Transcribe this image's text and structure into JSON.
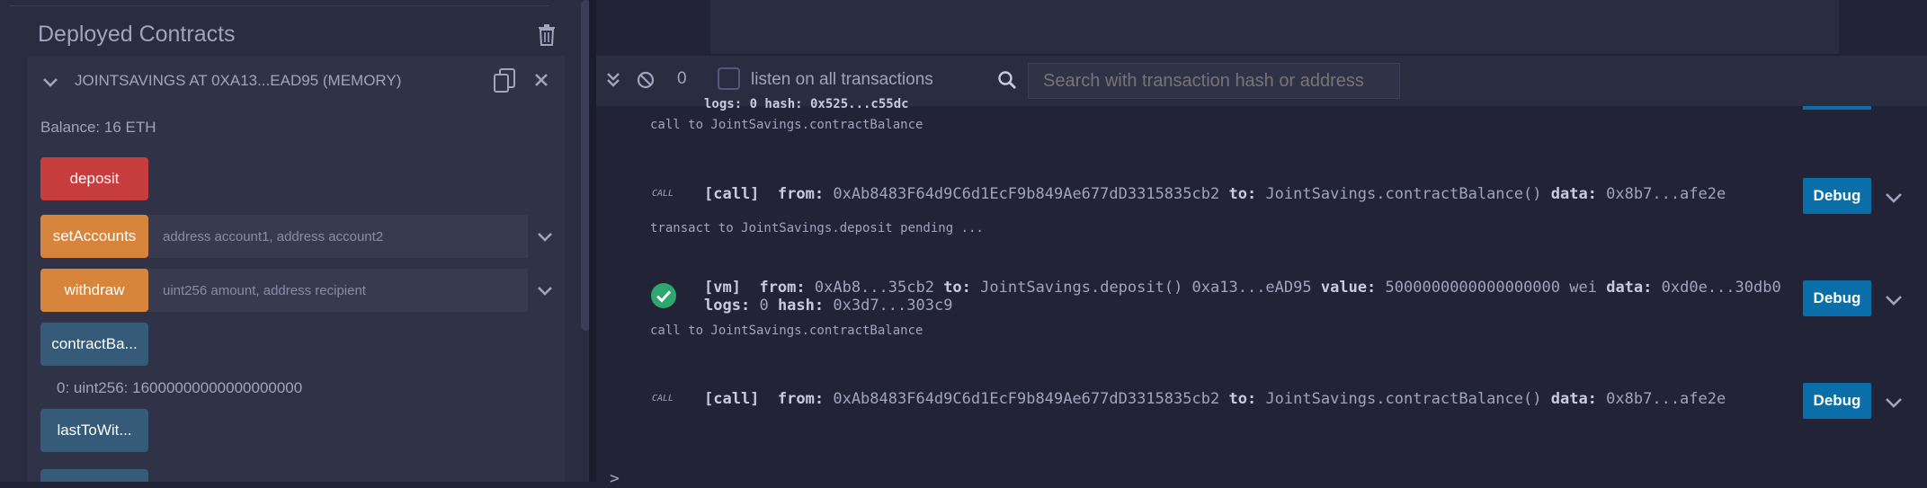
{
  "left_panel": {
    "section_title": "Deployed Contracts",
    "instance": {
      "title": "JOINTSAVINGS AT 0XA13...EAD95 (MEMORY)",
      "balance": "Balance: 16 ETH",
      "functions": [
        {
          "label": "deposit",
          "kind": "payable"
        },
        {
          "label": "setAccounts",
          "kind": "nonpayable",
          "placeholder": "address account1, address account2"
        },
        {
          "label": "withdraw",
          "kind": "nonpayable",
          "placeholder": "uint256 amount, address recipient"
        },
        {
          "label": "contractBa...",
          "kind": "view"
        },
        {
          "label": "lastToWit...",
          "kind": "view"
        }
      ],
      "output": "0: uint256: 16000000000000000000"
    }
  },
  "terminal": {
    "pending_count": "0",
    "listen_label": "listen on all transactions",
    "search_placeholder": "Search with transaction hash or address",
    "partial_top": "logs: 0 hash: 0x525...c55dc",
    "entries": [
      {
        "type": "info",
        "text": "call to JointSavings.contractBalance"
      },
      {
        "type": "call",
        "badge": "CALL",
        "tag": "[call]",
        "from_label": "from:",
        "from": "0xAb8483F64d9C6d1EcF9b849Ae677dD3315835cb2",
        "to_label": "to:",
        "to": "JointSavings.contractBalance()",
        "data_label": "data:",
        "data": "0x8b7...afe2e",
        "debug": "Debug"
      },
      {
        "type": "info",
        "text": "transact to JointSavings.deposit pending ..."
      },
      {
        "type": "vm",
        "tag": "[vm]",
        "from_label": "from:",
        "from": "0xAb8...35cb2",
        "to_label": "to:",
        "to": "JointSavings.deposit() 0xa13...eAD95",
        "value_label": "value:",
        "value": "5000000000000000000 wei",
        "data_label": "data:",
        "data": "0xd0e...30db0",
        "logs_label": "logs:",
        "logs": "0",
        "hash_label": "hash:",
        "hash": "0x3d7...303c9",
        "debug": "Debug"
      },
      {
        "type": "info",
        "text": "call to JointSavings.contractBalance"
      },
      {
        "type": "call",
        "badge": "CALL",
        "tag": "[call]",
        "from_label": "from:",
        "from": "0xAb8483F64d9C6d1EcF9b849Ae677dD3315835cb2",
        "to_label": "to:",
        "to": "JointSavings.contractBalance()",
        "data_label": "data:",
        "data": "0x8b7...afe2e",
        "debug": "Debug"
      }
    ],
    "prompt": ">"
  },
  "colors": {
    "btn_payable": "#c73c3c",
    "btn_transact": "#d7853d",
    "btn_call": "#365b78",
    "debug_btn": "#0a6fa8",
    "success": "#2ea66f"
  }
}
